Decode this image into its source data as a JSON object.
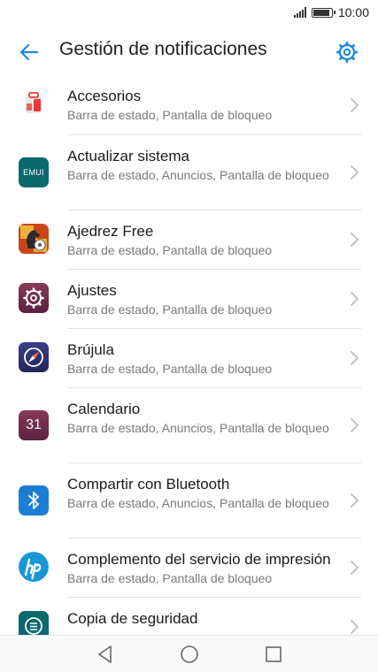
{
  "status": {
    "time": "10:00",
    "battery_level": 0.9
  },
  "header": {
    "title": "Gestión de notificaciones",
    "back_icon": "arrow-left-icon",
    "settings_icon": "gear-icon"
  },
  "colors": {
    "accent": "#1a88e0",
    "divider": "#e3e3e3",
    "subtext": "#7a7a7a"
  },
  "apps": [
    {
      "name": "Accesorios",
      "sub": "Barra de estado, Pantalla de bloqueo",
      "icon": "accessories-icon"
    },
    {
      "name": "Actualizar sistema",
      "sub": "Barra de estado, Anuncios, Pantalla de bloqueo",
      "icon": "emui-update-icon",
      "icon_text": "EMUI"
    },
    {
      "name": "Ajedrez Free",
      "sub": "Barra de estado, Pantalla de bloqueo",
      "icon": "chess-icon"
    },
    {
      "name": "Ajustes",
      "sub": "Barra de estado, Pantalla de bloqueo",
      "icon": "settings-app-icon"
    },
    {
      "name": "Brújula",
      "sub": "Barra de estado, Pantalla de bloqueo",
      "icon": "compass-icon"
    },
    {
      "name": "Calendario",
      "sub": "Barra de estado, Anuncios, Pantalla de bloqueo",
      "icon": "calendar-icon",
      "icon_text": "31"
    },
    {
      "name": "Compartir con Bluetooth",
      "sub": "Barra de estado, Anuncios, Pantalla de bloqueo",
      "icon": "bluetooth-icon"
    },
    {
      "name": "Complemento del servicio de impresión",
      "sub": "Barra de estado, Pantalla de bloqueo",
      "icon": "hp-print-icon"
    },
    {
      "name": "Copia de seguridad",
      "sub": "",
      "icon": "backup-icon"
    }
  ],
  "navbar": {
    "back_icon": "nav-back-icon",
    "home_icon": "nav-home-icon",
    "recents_icon": "nav-recents-icon"
  }
}
